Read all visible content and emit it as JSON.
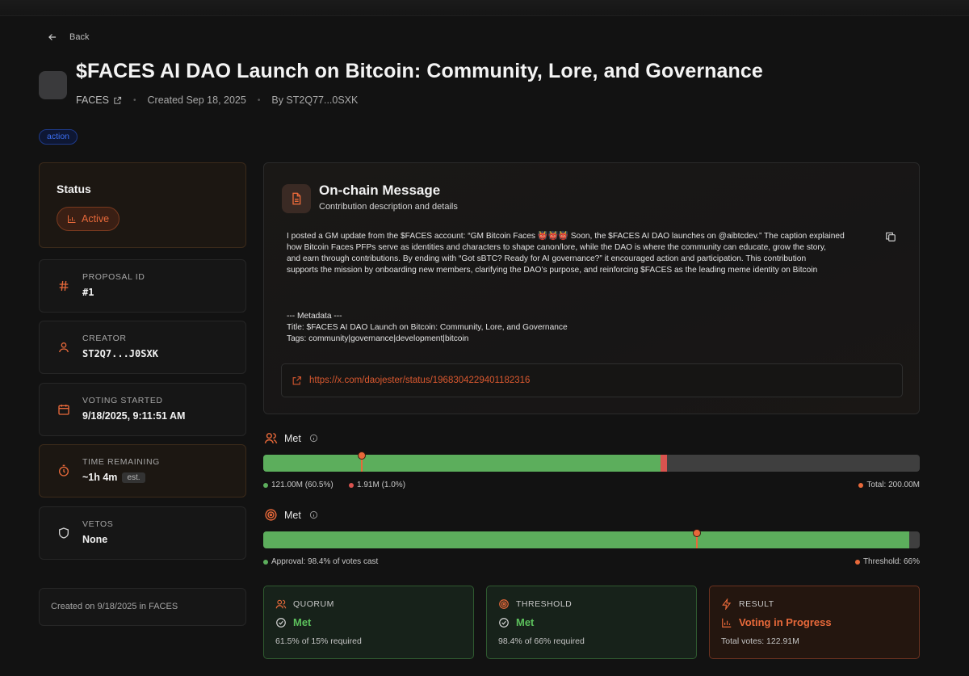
{
  "header": {
    "back_label": "Back",
    "title": "$FACES AI DAO Launch on Bitcoin: Community, Lore, and Governance",
    "dao_name": "FACES",
    "created": "Created Sep 18, 2025",
    "author": "By ST2Q77...0SXK",
    "tag": "action"
  },
  "status": {
    "heading": "Status",
    "badge": "Active"
  },
  "details": {
    "proposal_id_label": "PROPOSAL ID",
    "proposal_id": "#1",
    "creator_label": "CREATOR",
    "creator": "ST2Q7...J0SXK",
    "voting_started_label": "VOTING STARTED",
    "voting_started": "9/18/2025, 9:11:51 AM",
    "time_remaining_label": "TIME REMAINING",
    "time_remaining": "~1h 4m",
    "time_badge": "est.",
    "vetos_label": "VETOS",
    "vetos": "None",
    "footer": "Created on 9/18/2025 in FACES"
  },
  "message": {
    "title": "On-chain Message",
    "subtitle": "Contribution description and details",
    "body": "I posted a GM update from the $FACES account: “GM Bitcoin Faces 👹👹👹 Soon, the $FACES AI DAO launches on @aibtcdev.” The caption explained\nhow Bitcoin Faces PFPs serve as identities and characters to shape canon/lore, while the DAO is where the community can educate, grow the story,\nand earn through contributions. By ending with “Got sBTC? Ready for AI governance?” it encouraged action and participation. This contribution\nsupports the mission by onboarding new members, clarifying the DAO’s purpose, and reinforcing $FACES as the leading meme identity on Bitcoin\n\n\n\n--- Metadata ---\nTitle: $FACES AI DAO Launch on Bitcoin: Community, Lore, and Governance\nTags: community|governance|development|bitcoin",
    "link": "https://x.com/daojester/status/1968304229401182316"
  },
  "quorum_bar": {
    "label": "Met",
    "for_fraction": 0.605,
    "against_fraction": 0.01,
    "marker_fraction": 0.15,
    "for_legend": "121.00M (60.5%)",
    "against_legend": "1.91M (1.0%)",
    "total_legend": "Total: 200.00M"
  },
  "threshold_bar": {
    "label": "Met",
    "approval_fraction": 0.984,
    "marker_fraction": 0.66,
    "approval_legend": "Approval: 98.4% of votes cast",
    "threshold_legend": "Threshold: 66%"
  },
  "summary": {
    "quorum_label": "QUORUM",
    "quorum_value": "Met",
    "quorum_sub": "61.5% of 15% required",
    "threshold_label": "THRESHOLD",
    "threshold_value": "Met",
    "threshold_sub": "98.4% of 66% required",
    "result_label": "RESULT",
    "result_value": "Voting in Progress",
    "result_sub": "Total votes: 122.91M"
  },
  "colors": {
    "accent": "#e8693a",
    "for": "#5cae5c",
    "against": "#d9534f",
    "tag": "#3b6ef0"
  },
  "icons": [
    "arrow-left-icon",
    "external-link-icon",
    "bar-chart-icon",
    "hash-icon",
    "user-icon",
    "calendar-icon",
    "timer-icon",
    "shield-icon",
    "document-icon",
    "copy-icon",
    "users-icon",
    "info-icon",
    "target-icon",
    "check-circle-icon",
    "zap-icon"
  ]
}
